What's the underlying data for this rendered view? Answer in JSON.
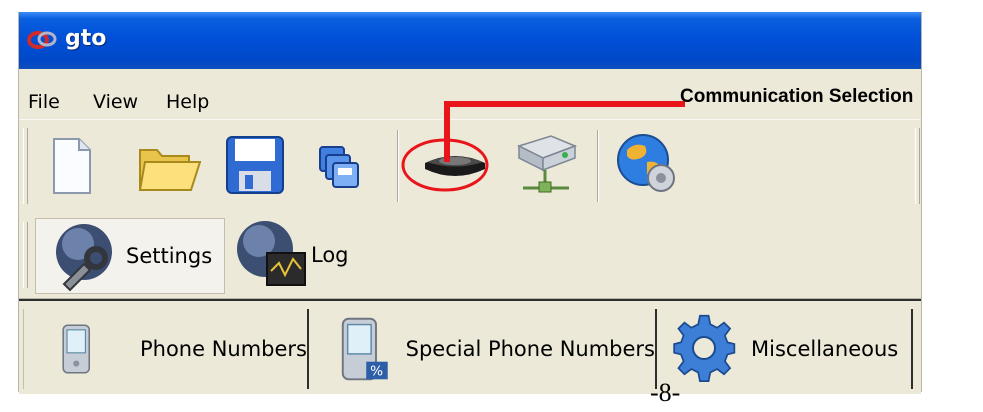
{
  "window": {
    "title": "gto"
  },
  "menubar": {
    "items": [
      "File",
      "View",
      "Help"
    ]
  },
  "toolbar": {
    "buttons": [
      {
        "icon": "new-document-icon"
      },
      {
        "icon": "open-folder-icon"
      },
      {
        "icon": "save-floppy-icon"
      },
      {
        "icon": "copy-documents-icon"
      },
      {
        "icon": "communication-device-icon"
      },
      {
        "icon": "network-drive-icon"
      },
      {
        "icon": "globe-web-icon"
      }
    ]
  },
  "callout": {
    "label": "Communication Selection",
    "color": "#e8151b"
  },
  "views": {
    "settings_label": "Settings",
    "log_label": "Log",
    "selected": "Settings"
  },
  "tabs": {
    "items": [
      "Phone Numbers",
      "Special Phone Numbers",
      "Miscellaneous"
    ],
    "selected": "Phone Numbers"
  },
  "page": {
    "number": "-8-"
  },
  "colors": {
    "titlebar": "#0050d8",
    "chrome": "#ece9d8",
    "highlight": "#e8151b"
  }
}
